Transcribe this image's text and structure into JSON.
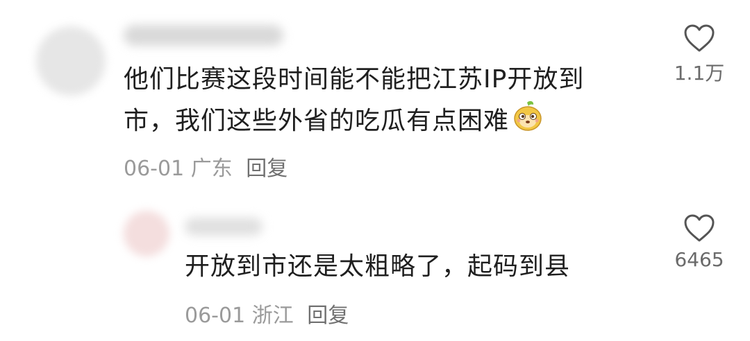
{
  "comments": [
    {
      "text_line1": "他们比赛这段时间能不能把江苏IP开放到",
      "text_line2": "市，我们这些外省的吃瓜有点困难",
      "date": "06-01",
      "location": "广东",
      "reply_label": "回复",
      "likes": "1.1万",
      "emoji": "melon-face-emoji"
    },
    {
      "text": "开放到市还是太粗略了，起码到县",
      "date": "06-01",
      "location": "浙江",
      "reply_label": "回复",
      "likes": "6465"
    }
  ],
  "icons": {
    "like": "heart-outline-icon"
  },
  "colors": {
    "text": "#1f1f1f",
    "meta": "#9a9a9a",
    "icon": "#555555"
  }
}
